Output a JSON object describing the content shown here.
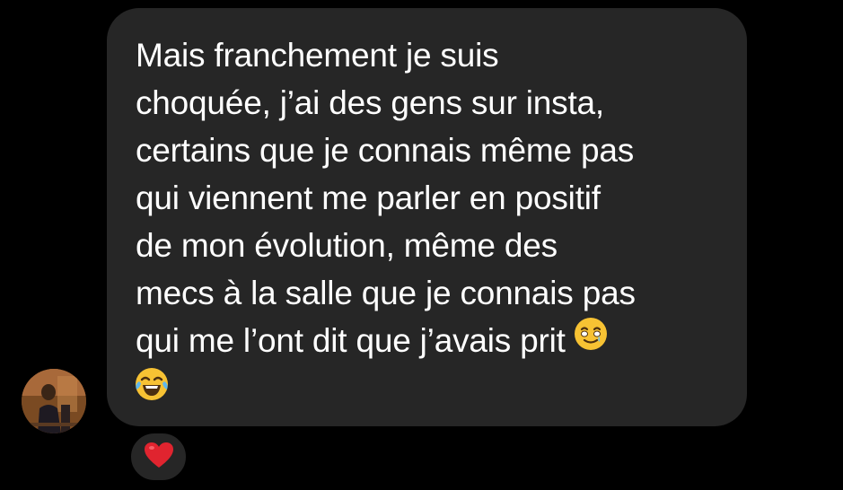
{
  "message": {
    "lines": [
      "Mais franchement je suis",
      "choquée, j’ai des gens sur insta,",
      "certains que je connais même pas",
      "qui viennent me parler en positif",
      "de mon évolution, même des",
      "mecs à la salle que je connais pas",
      "qui me l’ont dit que j’avais prit"
    ],
    "emojis": [
      "smiling-face-with-tear",
      "face-with-tears-of-joy"
    ]
  },
  "reaction": {
    "emoji": "red-heart",
    "color": "#e0242f"
  },
  "colors": {
    "background": "#000000",
    "bubble": "#262626",
    "text": "#ffffff",
    "emoji_yellow": "#f7c233"
  }
}
